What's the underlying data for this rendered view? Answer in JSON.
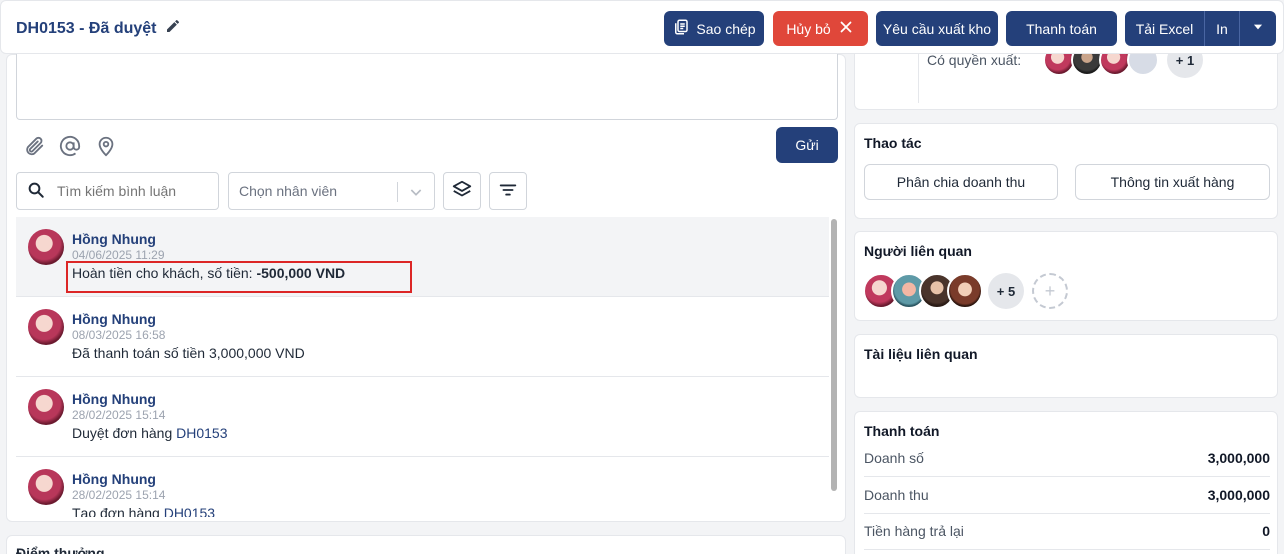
{
  "header": {
    "title": "DH0153 - Đã duyệt",
    "buttons": {
      "copy": "Sao chép",
      "cancel": "Hủy bỏ",
      "request_export": "Yêu cầu xuất kho",
      "payment": "Thanh toán",
      "excel": "Tải Excel",
      "print": "In"
    }
  },
  "comment_box": {
    "send_label": "Gửi",
    "search_placeholder": "Tìm kiếm bình luận",
    "employee_placeholder": "Chọn nhân viên"
  },
  "comments": [
    {
      "name": "Hồng Nhung",
      "time": "04/06/2025 11:29",
      "text_prefix": "Hoàn tiền cho khách, số tiền: ",
      "text_bold": "-500,000 VND",
      "link": ""
    },
    {
      "name": "Hồng Nhung",
      "time": "08/03/2025 16:58",
      "text_prefix": "Đã thanh toán số tiền 3,000,000 VND",
      "text_bold": "",
      "link": ""
    },
    {
      "name": "Hồng Nhung",
      "time": "28/02/2025 15:14",
      "text_prefix": "Duyệt đơn hàng ",
      "text_bold": "",
      "link": "DH0153"
    },
    {
      "name": "Hồng Nhung",
      "time": "28/02/2025 15:14",
      "text_prefix": "Tạo đơn hàng ",
      "text_bold": "",
      "link": "DH0153"
    }
  ],
  "bottom_section": {
    "title": "Điểm thưởng"
  },
  "export_rights": {
    "label": "Có quyền xuất:",
    "more": "+ 1"
  },
  "actions": {
    "title": "Thao tác",
    "revenue_split": "Phân chia doanh thu",
    "export_info": "Thông tin xuất hàng"
  },
  "related_people": {
    "title": "Người liên quan",
    "more": "+ 5",
    "add": "+"
  },
  "related_docs": {
    "title": "Tài liệu liên quan"
  },
  "payment": {
    "title": "Thanh toán",
    "rows": [
      {
        "label": "Doanh số",
        "value": "3,000,000"
      },
      {
        "label": "Doanh thu",
        "value": "3,000,000"
      },
      {
        "label": "Tiền hàng trả lại",
        "value": "0"
      }
    ]
  },
  "colors": {
    "brand": "#24407a",
    "danger": "#e0473a",
    "highlight": "#dc2626"
  }
}
